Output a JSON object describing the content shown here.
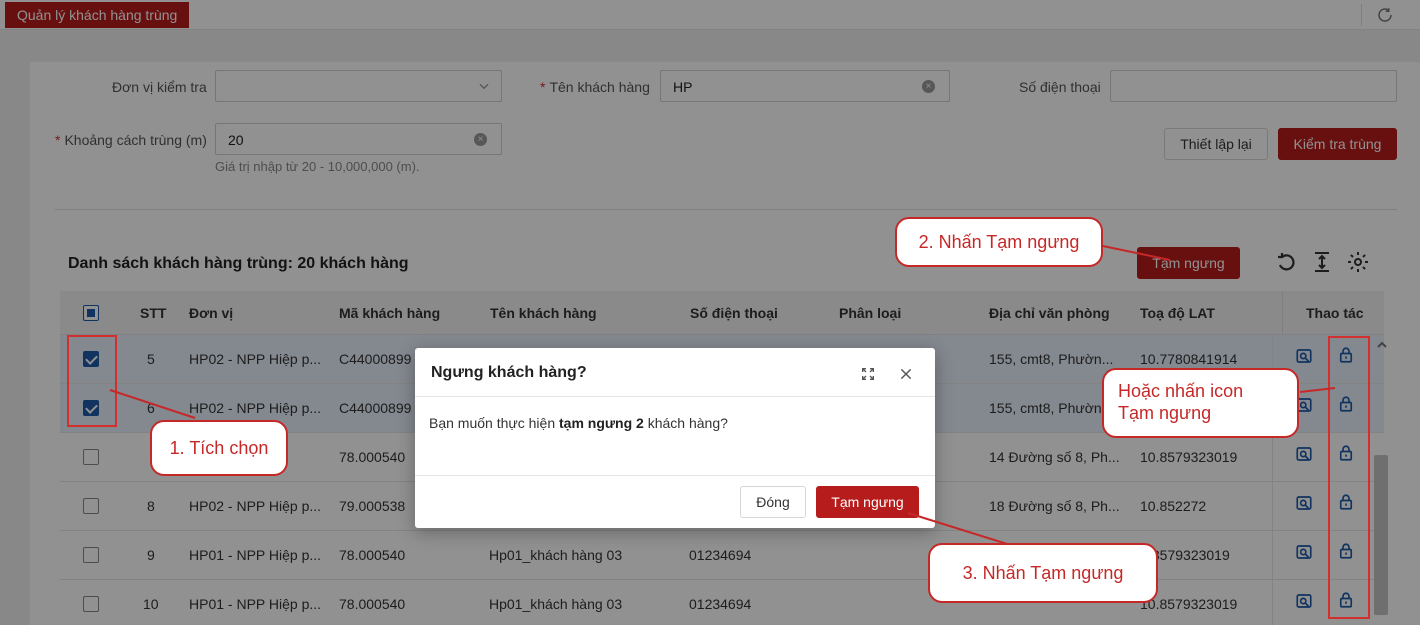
{
  "tab": {
    "active_label": "Quản lý khách hàng trùng"
  },
  "filters": {
    "don_vi_label": "Đơn vị kiểm tra",
    "don_vi_value": "",
    "ten_kh_label": "Tên khách hàng",
    "ten_kh_value": "HP",
    "sdt_label": "Số điện thoại",
    "sdt_value": "",
    "khoang_cach_label": "Khoảng cách trùng (m)",
    "khoang_cach_value": "20",
    "khoang_cach_hint": "Giá trị nhập từ 20 - 10,000,000 (m).",
    "required_mark": "*",
    "reset_label": "Thiết lập lại",
    "check_label": "Kiểm tra trùng"
  },
  "list": {
    "title": "Danh sách khách hàng trùng: 20 khách hàng",
    "suspend_label": "Tạm ngưng",
    "columns": [
      "STT",
      "Đơn vị",
      "Mã khách hàng",
      "Tên khách hàng",
      "Số điện thoại",
      "Phân loại",
      "Địa chỉ văn phòng",
      "Toạ độ LAT",
      "Thao tác"
    ],
    "rows": [
      {
        "checked": true,
        "stt": "5",
        "don_vi": "HP02 - NPP Hiệp p...",
        "ma_kh": "C44000899",
        "ten_kh": "",
        "sdt": "",
        "phan_loai": "",
        "dia_chi": "155, cmt8, Phườn...",
        "lat": "10.7780841914"
      },
      {
        "checked": true,
        "stt": "6",
        "don_vi": "HP02 - NPP Hiệp p...",
        "ma_kh": "C44000899",
        "ten_kh": "",
        "sdt": "",
        "phan_loai": "",
        "dia_chi": "155, cmt8, Phườn",
        "lat": ""
      },
      {
        "checked": false,
        "stt": "",
        "don_vi": "",
        "ma_kh": "78.000540",
        "ten_kh": "",
        "sdt": "",
        "phan_loai": "",
        "dia_chi": "14 Đường số 8, Ph...",
        "lat": "10.8579323019"
      },
      {
        "checked": false,
        "stt": "8",
        "don_vi": "HP02 - NPP Hiệp p...",
        "ma_kh": "79.000538",
        "ten_kh": "",
        "sdt": "",
        "phan_loai": "",
        "dia_chi": "18 Đường số 8, Ph...",
        "lat": "10.852272"
      },
      {
        "checked": false,
        "stt": "9",
        "don_vi": "HP01 - NPP Hiệp p...",
        "ma_kh": "78.000540",
        "ten_kh": "Hp01_khách hàng 03",
        "sdt": "01234694",
        "phan_loai": "",
        "dia_chi": "",
        "lat": ".8579323019"
      },
      {
        "checked": false,
        "stt": "10",
        "don_vi": "HP01 - NPP Hiệp p...",
        "ma_kh": "78.000540",
        "ten_kh": "Hp01_khách hàng 03",
        "sdt": "01234694",
        "phan_loai": "",
        "dia_chi": "",
        "lat": "10.8579323019"
      }
    ]
  },
  "dialog": {
    "title": "Ngưng khách hàng?",
    "msg_pre": "Bạn muốn thực hiện",
    "msg_bold": "tạm ngưng 2",
    "msg_post": "khách hàng?",
    "close_label": "Đóng",
    "confirm_label": "Tạm ngưng"
  },
  "callouts": {
    "step1": "1. Tích chọn",
    "step2": "2. Nhấn Tạm ngưng",
    "step3": "3. Nhấn Tạm ngưng",
    "alt_line1": "Hoặc nhấn icon",
    "alt_line2": "Tạm ngưng"
  },
  "colors": {
    "brand": "#b71c1c",
    "annotation": "#c62828",
    "icon": "#1e5aa8"
  }
}
